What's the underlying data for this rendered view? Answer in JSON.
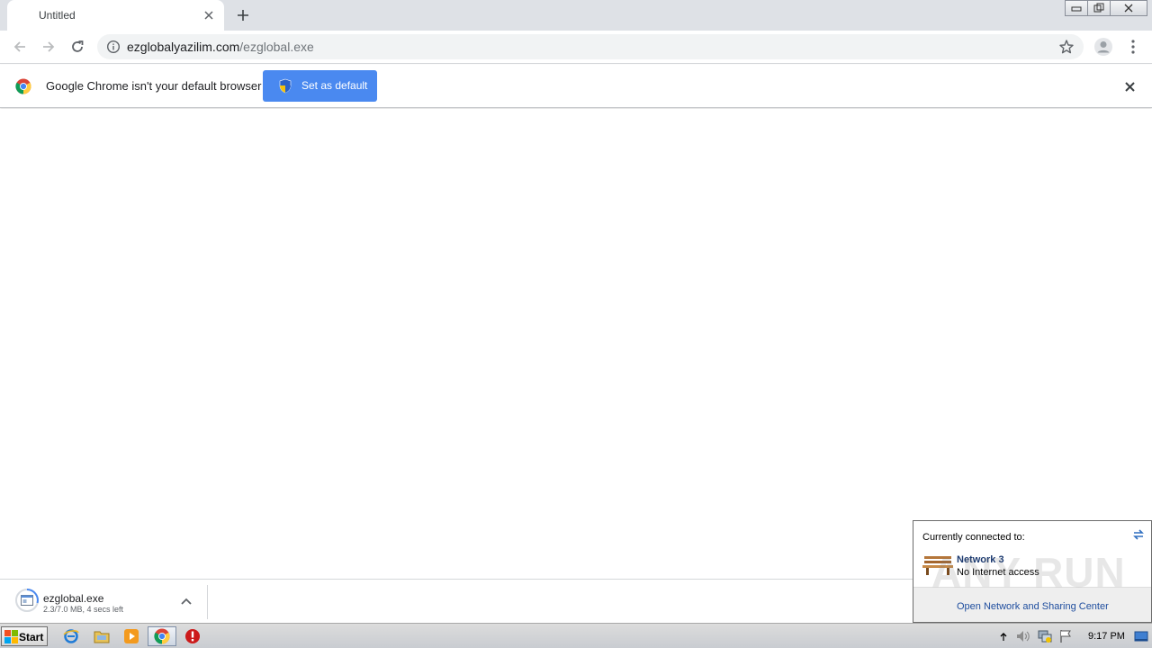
{
  "window": {
    "tab_title": "Untitled"
  },
  "toolbar": {
    "url_host": "ezglobalyazilim.com",
    "url_path": "/ezglobal.exe"
  },
  "infobar": {
    "message": "Google Chrome isn't your default browser",
    "button_label": "Set as default"
  },
  "download": {
    "filename": "ezglobal.exe",
    "status": "2.3/7.0 MB, 4 secs left"
  },
  "network_popup": {
    "header": "Currently connected to:",
    "network_name": "Network  3",
    "network_status": "No Internet access",
    "link": "Open Network and Sharing Center",
    "watermark": "ANY  RUN"
  },
  "taskbar": {
    "start_label": "Start",
    "clock": "9:17 PM"
  },
  "colors": {
    "tabstrip": "#dee1e6",
    "accent_button": "#4a89f0",
    "omnibox": "#f1f3f4"
  }
}
